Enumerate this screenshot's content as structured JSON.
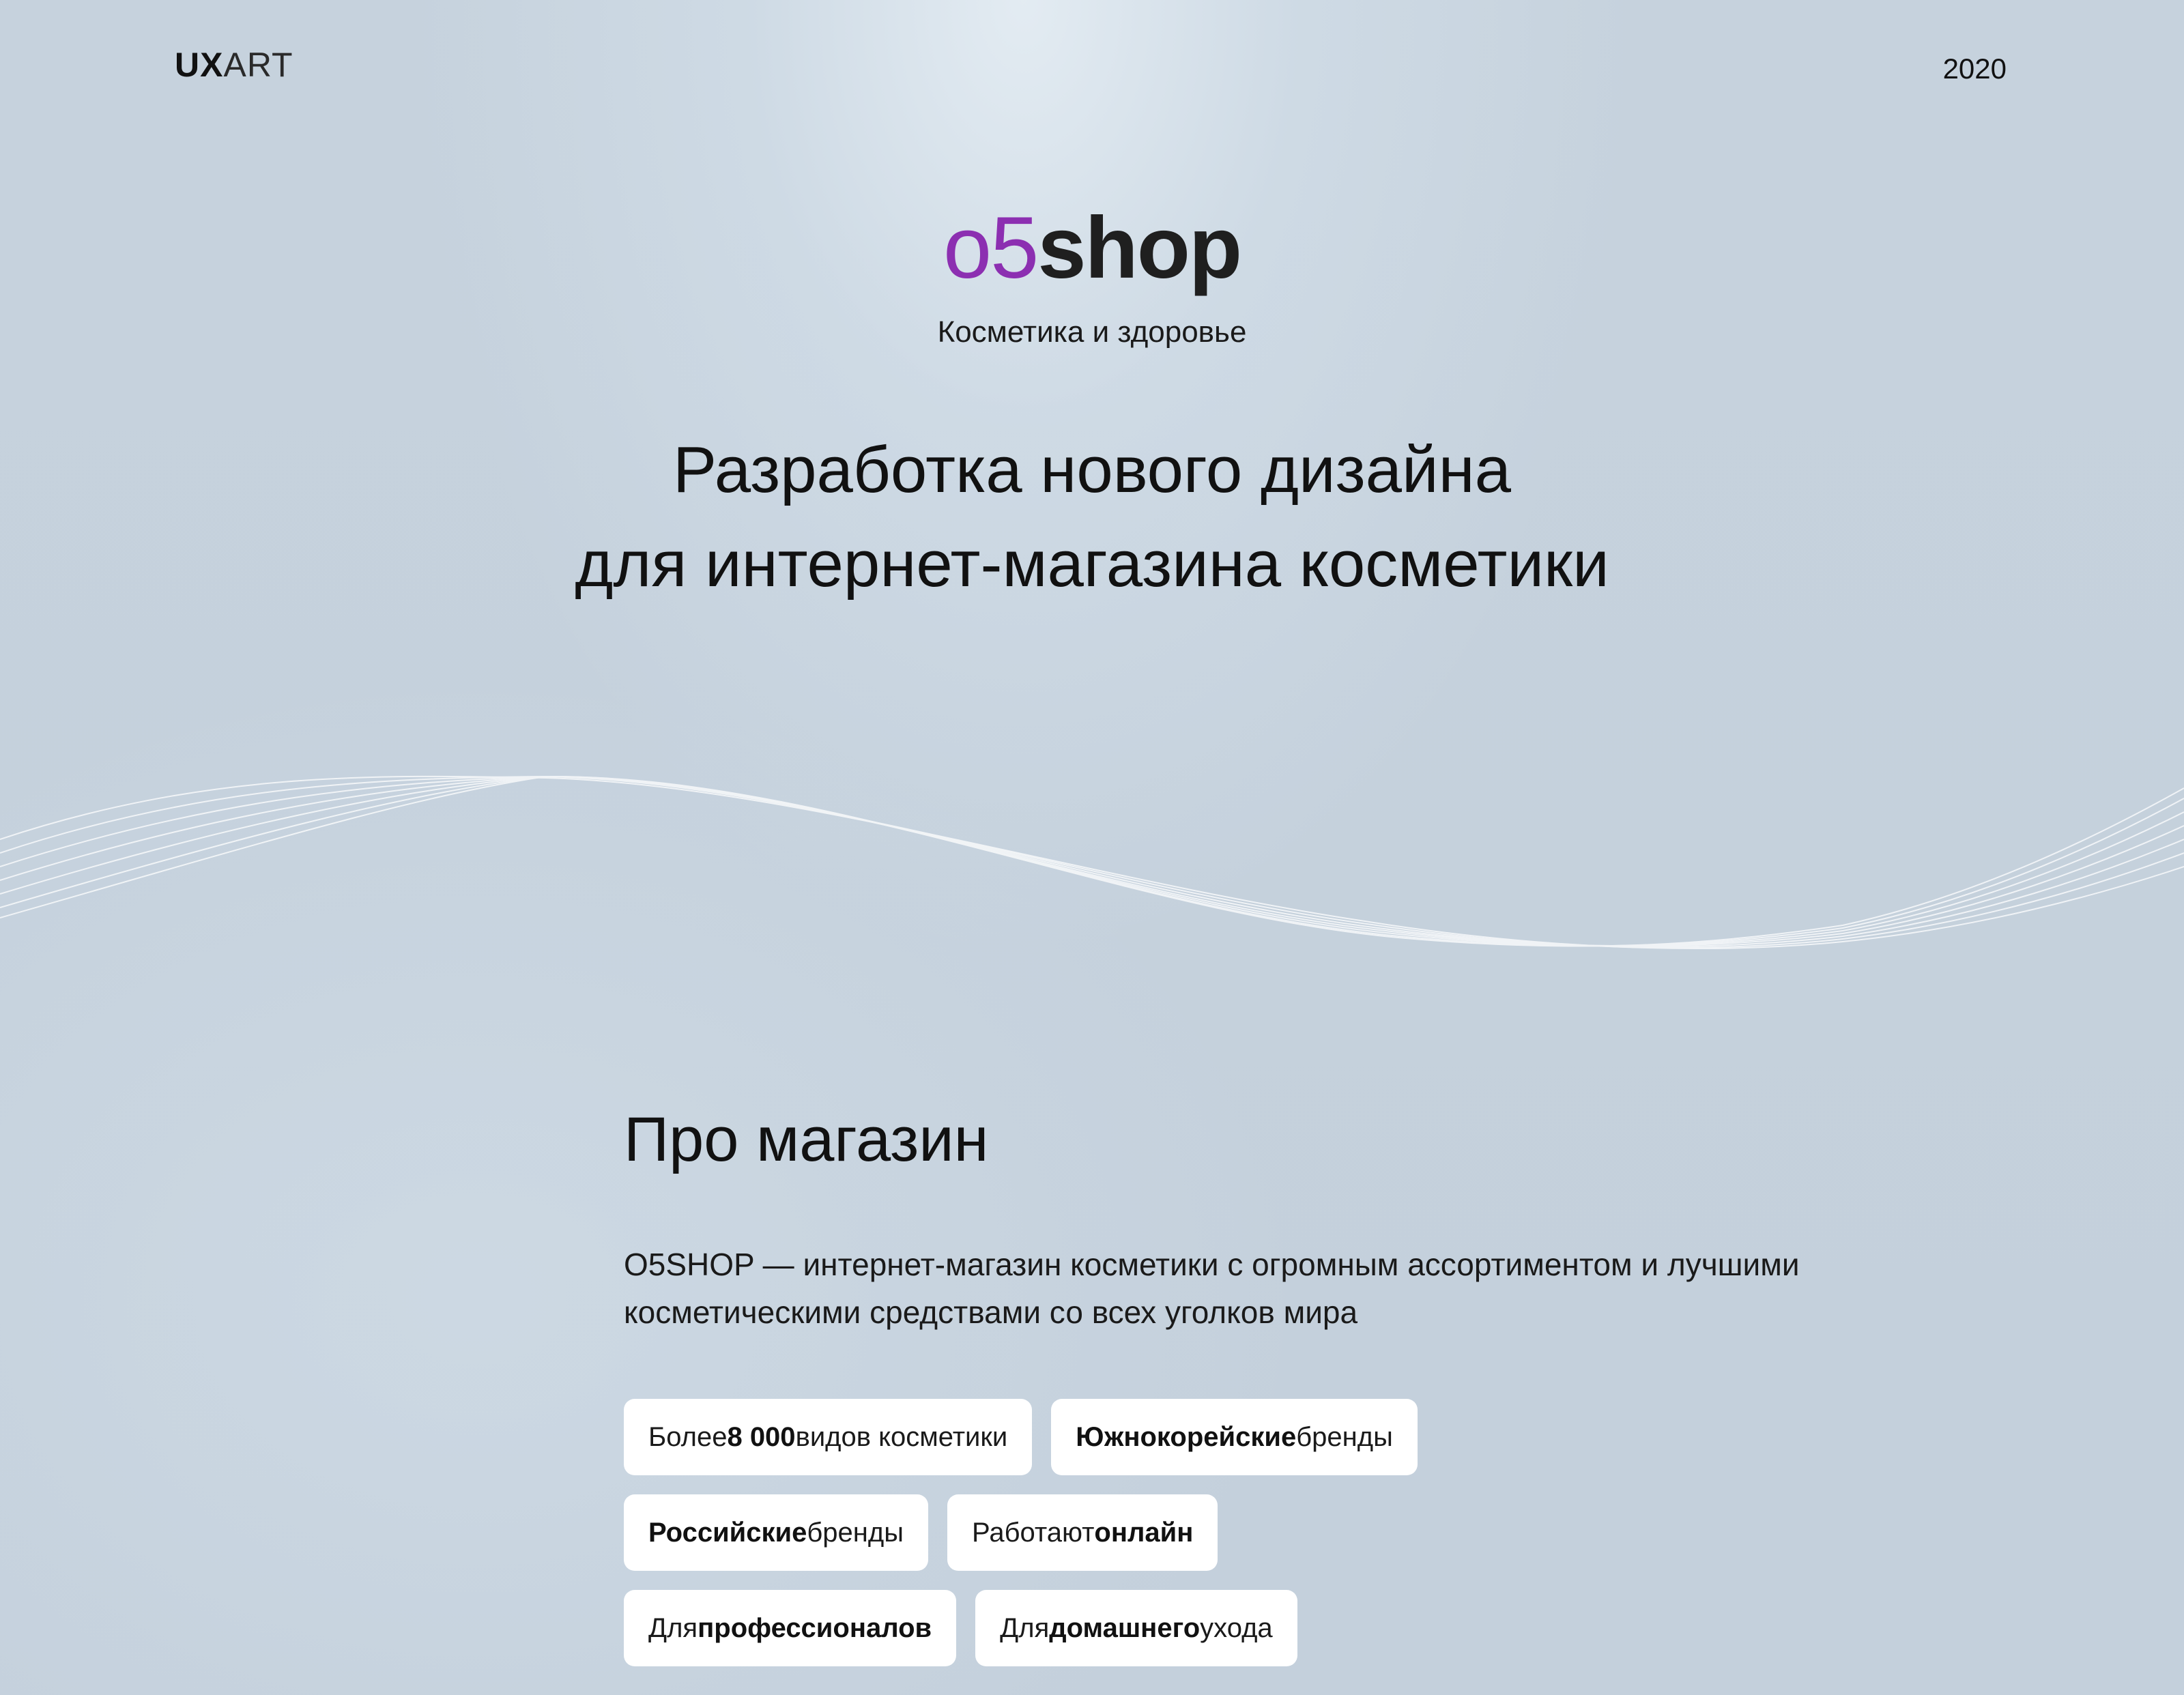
{
  "header": {
    "logo_bold": "UX",
    "logo_light": "ART",
    "year": "2020"
  },
  "brand": {
    "name_accent": "o5",
    "name_rest": "shop",
    "accent_color": "#8c2fb1",
    "tagline": "Косметика и здоровье"
  },
  "headline": {
    "line1": "Разработка нового дизайна",
    "line2": "для интернет-магазина косметики"
  },
  "about": {
    "title": "Про магазин",
    "description": "O5SHOP — интернет-магазин косметики с огромным ассортиментом и лучшими косметическими средствами со всех уголков мира"
  },
  "chips": [
    {
      "pre": "Более ",
      "bold": "8 000",
      "post": " видов косметики"
    },
    {
      "pre": "",
      "bold": "Южнокорейские",
      "post": " бренды"
    },
    {
      "pre": "",
      "bold": "Российские",
      "post": " бренды"
    },
    {
      "pre": "Работают ",
      "bold": "онлайн",
      "post": ""
    },
    {
      "pre": "Для ",
      "bold": "профессионалов",
      "post": ""
    },
    {
      "pre": "Для ",
      "bold": "домашнего",
      "post": " ухода"
    }
  ]
}
